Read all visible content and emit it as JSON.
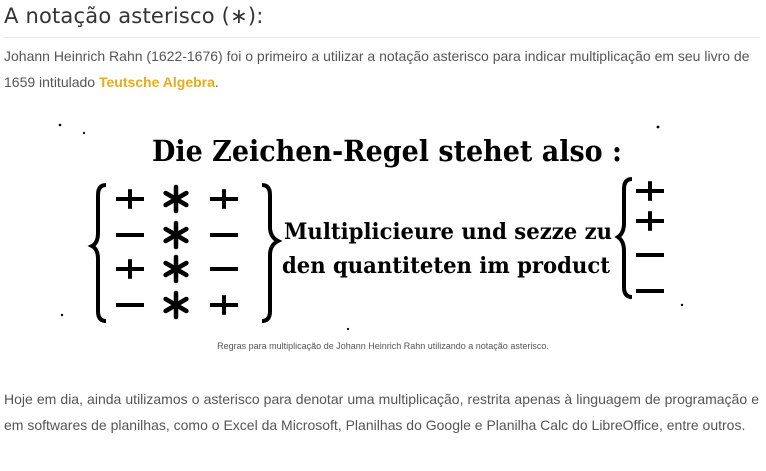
{
  "heading": "A notação asterisco (∗):",
  "intro": {
    "text_before": "Johann Heinrich Rahn (1622-1676) foi o primeiro a utilizar a notação asterisco para indicar multiplicação em seu livro de 1659 intitulado ",
    "link_text": "Teutsche Algebra",
    "text_after": "."
  },
  "figure": {
    "title_line": "Die Zeichen-Regel stehet also :",
    "text_line_1": "Multiplicieure und sezze zu",
    "text_line_2": "den quantiteten im product",
    "rows": [
      {
        "a": "+",
        "op": "∗",
        "b": "+",
        "r": "+"
      },
      {
        "a": "−",
        "op": "∗",
        "b": "−",
        "r": "+"
      },
      {
        "a": "+",
        "op": "∗",
        "b": "−",
        "r": "−"
      },
      {
        "a": "−",
        "op": "∗",
        "b": "+",
        "r": "−"
      }
    ],
    "caption": "Regras para multiplicação de Johann Heinrich Rahn utilizando a notação asterisco."
  },
  "outro": "Hoje em dia, ainda utilizamos o asterisco para denotar uma multiplicação, restrita apenas à linguagem de programação e em softwares de planilhas, como o Excel da Microsoft, Planilhas do Google e Planilha Calc do LibreOffice, entre outros.",
  "colors": {
    "link": "#e6ac1f",
    "text": "#555555",
    "heading": "#333333"
  }
}
